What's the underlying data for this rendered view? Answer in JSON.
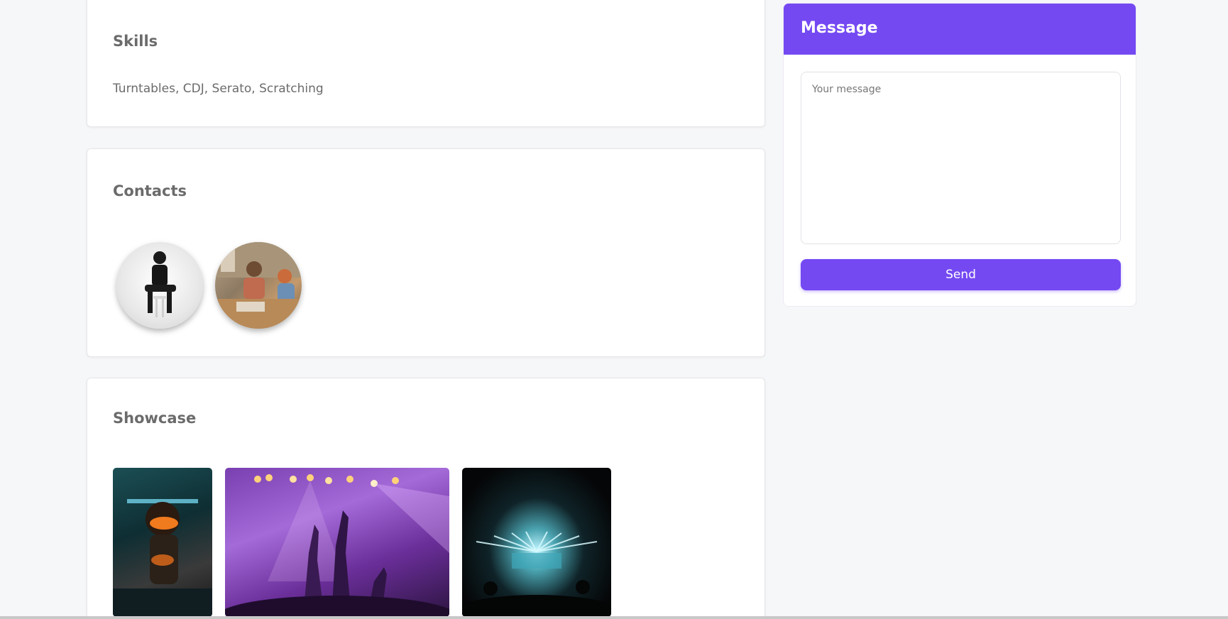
{
  "skills": {
    "title": "Skills",
    "text": "Turntables, CDJ, Serato, Scratching"
  },
  "contacts": {
    "title": "Contacts"
  },
  "showcase": {
    "title": "Showcase"
  },
  "message": {
    "title": "Message",
    "placeholder": "Your message",
    "send_label": "Send"
  },
  "colors": {
    "accent": "#7449f2",
    "background": "#f6f7f9"
  }
}
